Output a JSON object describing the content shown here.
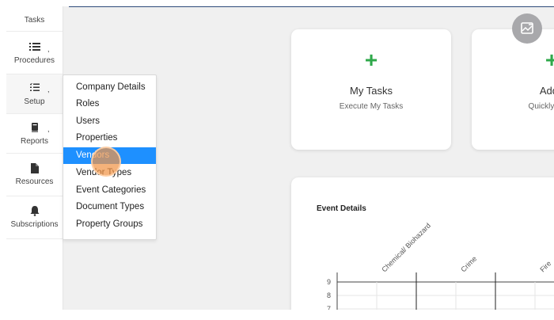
{
  "sidebar": {
    "items": [
      {
        "label": "Tasks",
        "icon": "tasks-icon",
        "caret": ""
      },
      {
        "label": "Procedures",
        "icon": "list-icon",
        "caret": ","
      },
      {
        "label": "Setup",
        "icon": "checklist-icon",
        "caret": ","
      },
      {
        "label": "Reports",
        "icon": "book-icon",
        "caret": ","
      },
      {
        "label": "Resources",
        "icon": "file-icon",
        "caret": ""
      },
      {
        "label": "Subscriptions",
        "icon": "bell-icon",
        "caret": ""
      }
    ]
  },
  "setup_menu": {
    "items": [
      "Company Details",
      "Roles",
      "Users",
      "Properties",
      "Vendors",
      "Vendor Types",
      "Event Categories",
      "Document Types",
      "Property Groups"
    ],
    "selected": "Vendors"
  },
  "cards": [
    {
      "plus": "+",
      "title": "My Tasks",
      "subtitle": "Execute My Tasks"
    },
    {
      "plus": "+",
      "title": "Add I",
      "subtitle": "Quickly repor"
    }
  ],
  "chart_panel": {
    "title": "Event Details"
  },
  "chart_data": {
    "type": "bar",
    "categories": [
      "Chemical/ Biohazard",
      "Crime",
      "Fire"
    ],
    "values": [],
    "title": "",
    "xlabel": "",
    "ylabel": "",
    "yticks": [
      "9",
      "8",
      "7"
    ]
  },
  "colors": {
    "accent": "#1e90ff",
    "plus": "#2ea84a",
    "fab": "#a8a8ab"
  }
}
